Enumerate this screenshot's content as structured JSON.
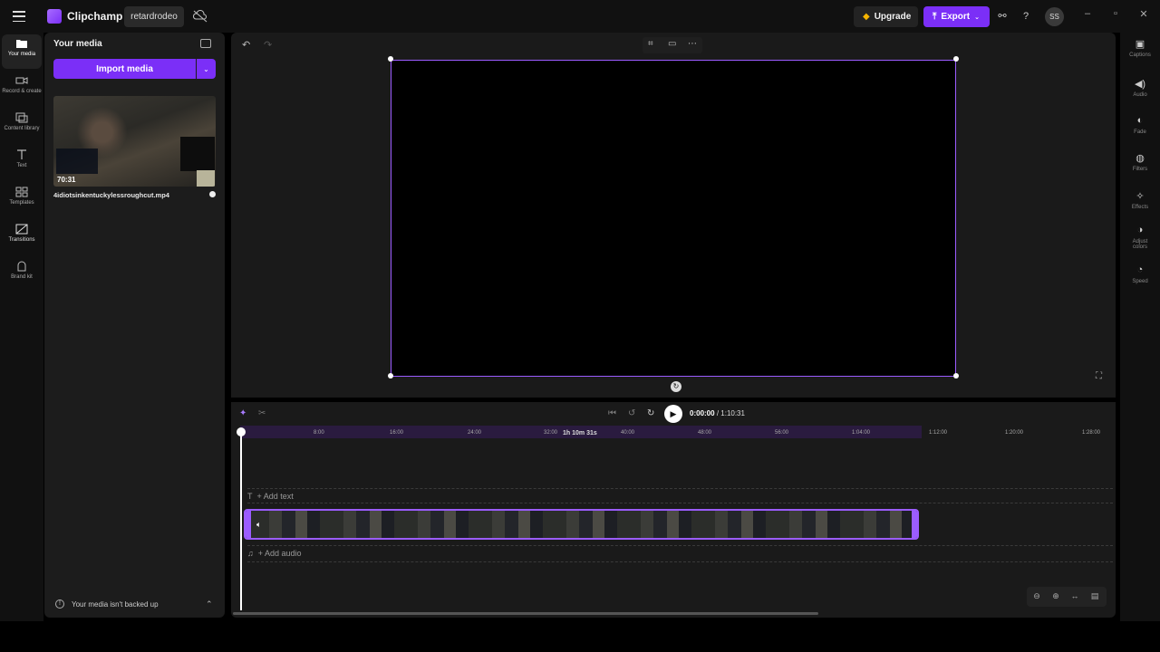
{
  "app": {
    "brand": "Clipchamp",
    "project_name": "retardrodeo"
  },
  "topbar": {
    "upgrade_label": "Upgrade",
    "export_label": "Export",
    "avatar_initials": "SS"
  },
  "left_nav": [
    {
      "label": "Your media",
      "icon": "folder-icon"
    },
    {
      "label": "Record & create",
      "icon": "camera-icon"
    },
    {
      "label": "Content library",
      "icon": "library-icon"
    },
    {
      "label": "Text",
      "icon": "text-icon"
    },
    {
      "label": "Templates",
      "icon": "templates-icon"
    },
    {
      "label": "Transitions",
      "icon": "transitions-icon"
    },
    {
      "label": "Brand kit",
      "icon": "brand-kit-icon"
    }
  ],
  "media_panel": {
    "title": "Your media",
    "import_label": "Import media",
    "items": [
      {
        "filename": "4idiotsinkentuckylessroughcut.mp4",
        "duration": "70:31"
      }
    ],
    "backup_notice": "Your media isn't backed up"
  },
  "player": {
    "current_time": "0:00:00",
    "total_time": "1:10:31"
  },
  "timeline": {
    "ticks": [
      "8:00",
      "16:00",
      "24:00",
      "32:00",
      "40:00",
      "48:00",
      "56:00",
      "1:04:00",
      "1:12:00",
      "1:20:00",
      "1:28:00"
    ],
    "clip_duration_label": "1h 10m 31s",
    "add_text_label": "+ Add text",
    "add_audio_label": "+ Add audio"
  },
  "right_nav": [
    {
      "label": "Captions",
      "icon": "captions-icon"
    },
    {
      "label": "Audio",
      "icon": "audio-icon"
    },
    {
      "label": "Fade",
      "icon": "fade-icon"
    },
    {
      "label": "Filters",
      "icon": "filters-icon"
    },
    {
      "label": "Effects",
      "icon": "effects-icon"
    },
    {
      "label": "Adjust colors",
      "icon": "adjust-colors-icon"
    },
    {
      "label": "Speed",
      "icon": "speed-icon"
    }
  ],
  "colors": {
    "accent": "#7b2ff7",
    "selection": "#9b5cff",
    "background": "#000000"
  }
}
